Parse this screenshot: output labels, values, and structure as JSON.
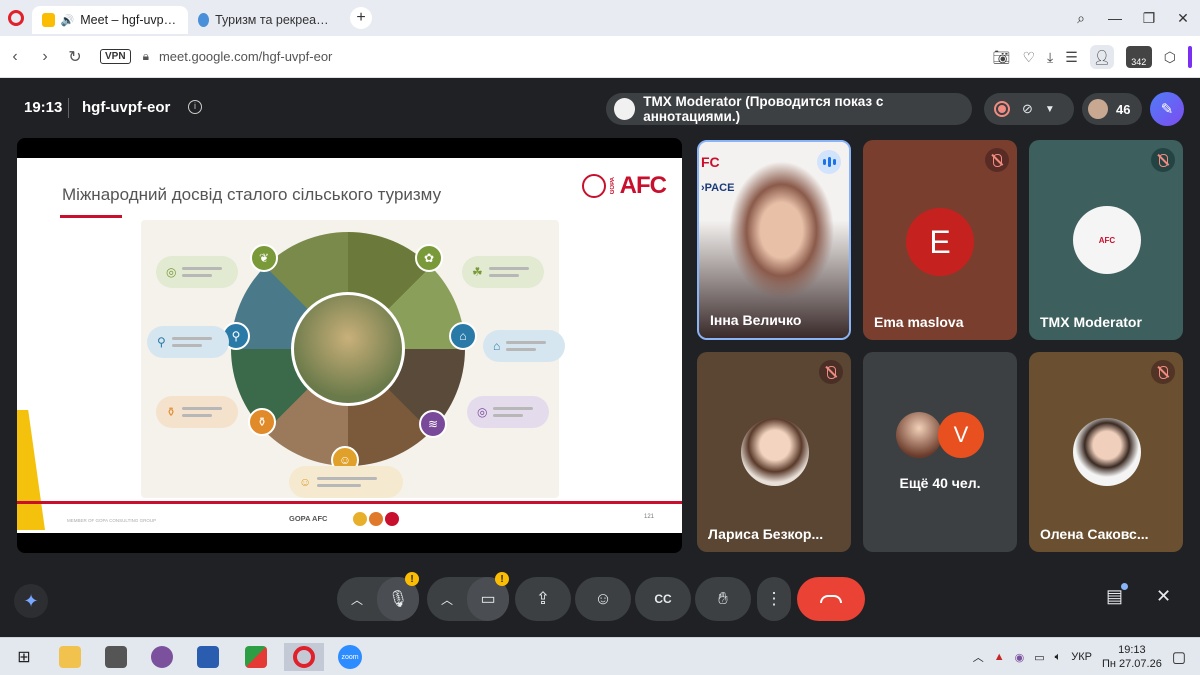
{
  "browser": {
    "tabs": [
      {
        "title": "Meet – hgf-uvpf-eor",
        "active": true
      },
      {
        "title": "Туризм та рекреація | Бан",
        "active": false
      }
    ],
    "new_tab": "+",
    "vpn": "VPN",
    "url": "meet.google.com/hgf-uvpf-eor",
    "badge": "342"
  },
  "meet": {
    "time": "19:13",
    "code": "hgf-uvpf-eor",
    "presenting_label": "TMX Moderator (Проводится показ с аннотациями.)",
    "participant_count": "46",
    "slide": {
      "title": "Міжнародний досвід сталого сільського туризму",
      "logo_text": "AFC",
      "logo_vertical": "GOPA",
      "footer_brand": "GOPA AFC",
      "footer_small": "MEMBER OF GOPA CONSULTING GROUP",
      "page_number": "121"
    },
    "tiles": [
      {
        "name": "Інна Величко",
        "state": "speaking"
      },
      {
        "name": "Ema maslova",
        "avatar_letter": "E",
        "state": "muted"
      },
      {
        "name": "TMX Moderator",
        "state": "muted"
      },
      {
        "name": "Лариса Безкор...",
        "state": "muted"
      },
      {
        "more_letter": "V",
        "more_text": "Ещё 40 чел."
      },
      {
        "name": "Олена Саковс...",
        "state": "muted"
      }
    ],
    "colors": {
      "accent": "#1a73e8",
      "end_call": "#ea4335",
      "muted": "#f28b82",
      "warning": "#fbbc04"
    }
  },
  "taskbar": {
    "language": "УКР",
    "time": "19:13",
    "date": "Пн 27.07.26",
    "apps": [
      "file-explorer",
      "calculator",
      "viber",
      "save-disk",
      "green-app",
      "opera",
      "zoom"
    ],
    "zoom_label": "zoom"
  }
}
